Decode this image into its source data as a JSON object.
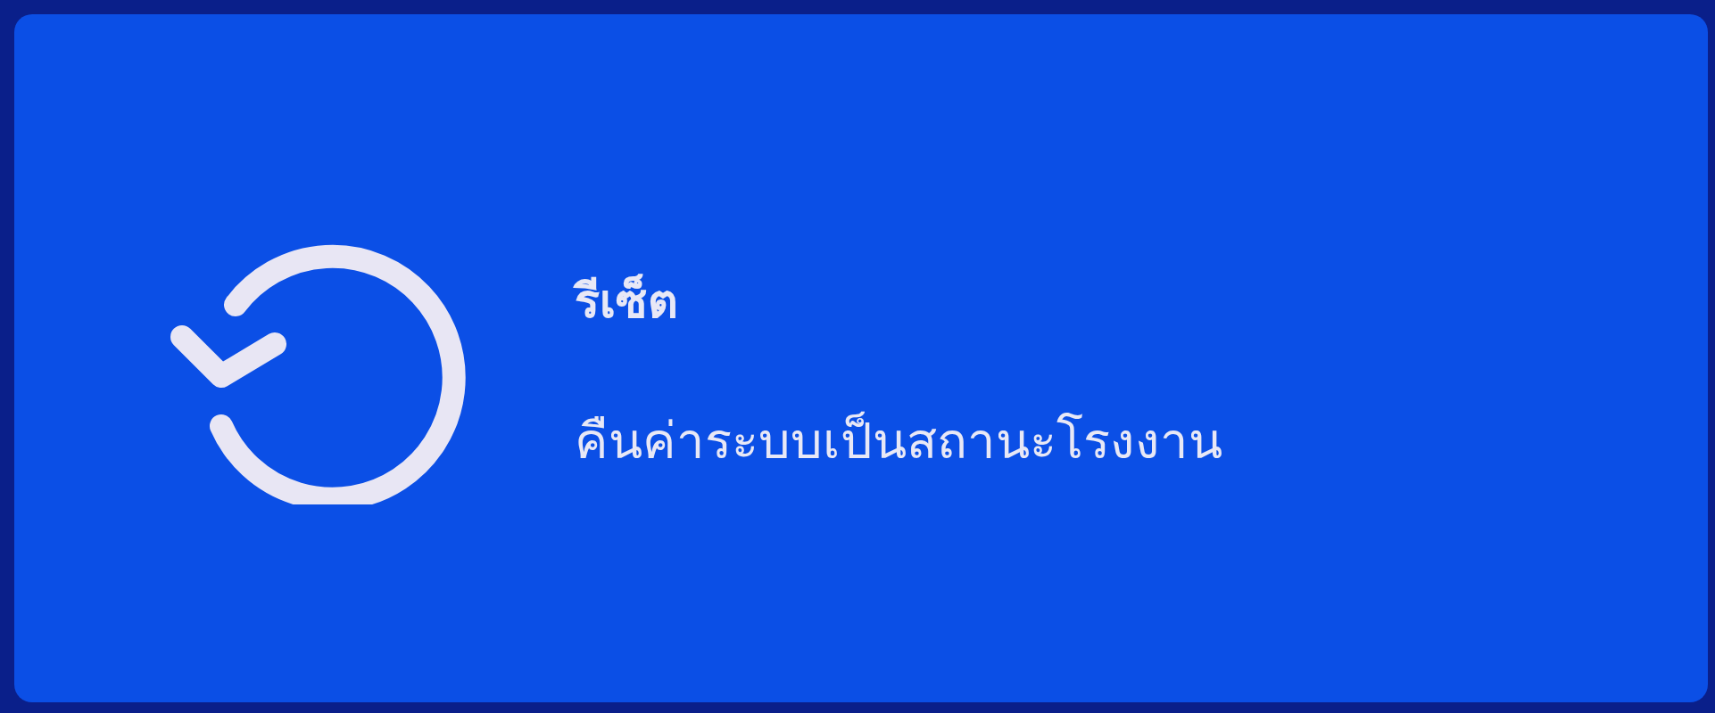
{
  "card": {
    "title": "รีเซ็ต",
    "description": "คืนค่าระบบเป็นสถานะโรงงาน"
  }
}
